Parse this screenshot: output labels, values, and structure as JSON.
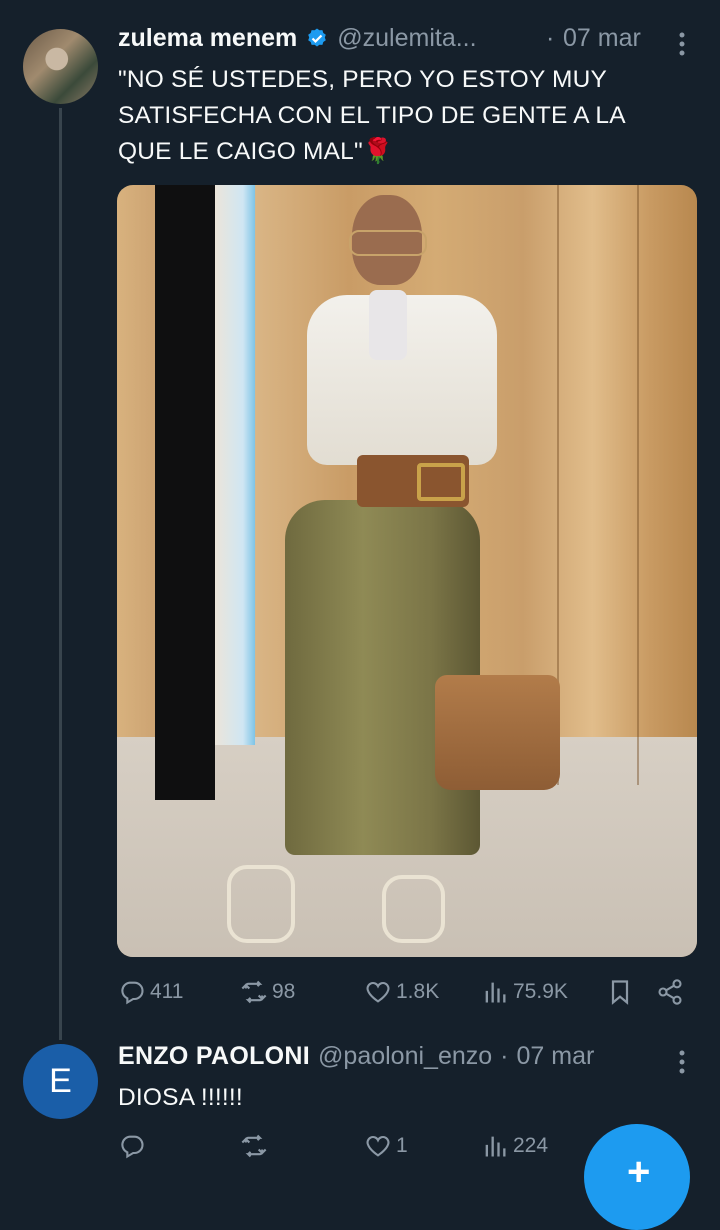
{
  "tweet1": {
    "author_name": "zulema menem",
    "handle": "@zulemita...",
    "separator": "·",
    "date": "07 mar",
    "verified": true,
    "text_line1": "\"NO SÉ USTEDES, PERO YO ESTOY MUY",
    "text_line2": "SATISFECHA CON EL TIPO DE GENTE A LA",
    "text_line3": "QUE LE CAIGO MAL\"",
    "text_emoji": "🌹",
    "replies": "411",
    "retweets": "98",
    "likes": "1.8K",
    "views": "75.9K"
  },
  "tweet2": {
    "avatar_letter": "E",
    "author_name": "ENZO PAOLONI",
    "handle": "@paoloni_enzo",
    "separator": "·",
    "date": "07 mar",
    "text": "DIOSA !!!!!!",
    "replies": "",
    "retweets": "",
    "likes": "1",
    "views": "224"
  },
  "fab": {
    "icon": "plus-icon",
    "label": "+"
  },
  "colors": {
    "background": "#15202b",
    "text": "#f7f9f9",
    "muted": "#8b98a5",
    "verified": "#1d9bf0",
    "accent": "#1d9bf0"
  }
}
